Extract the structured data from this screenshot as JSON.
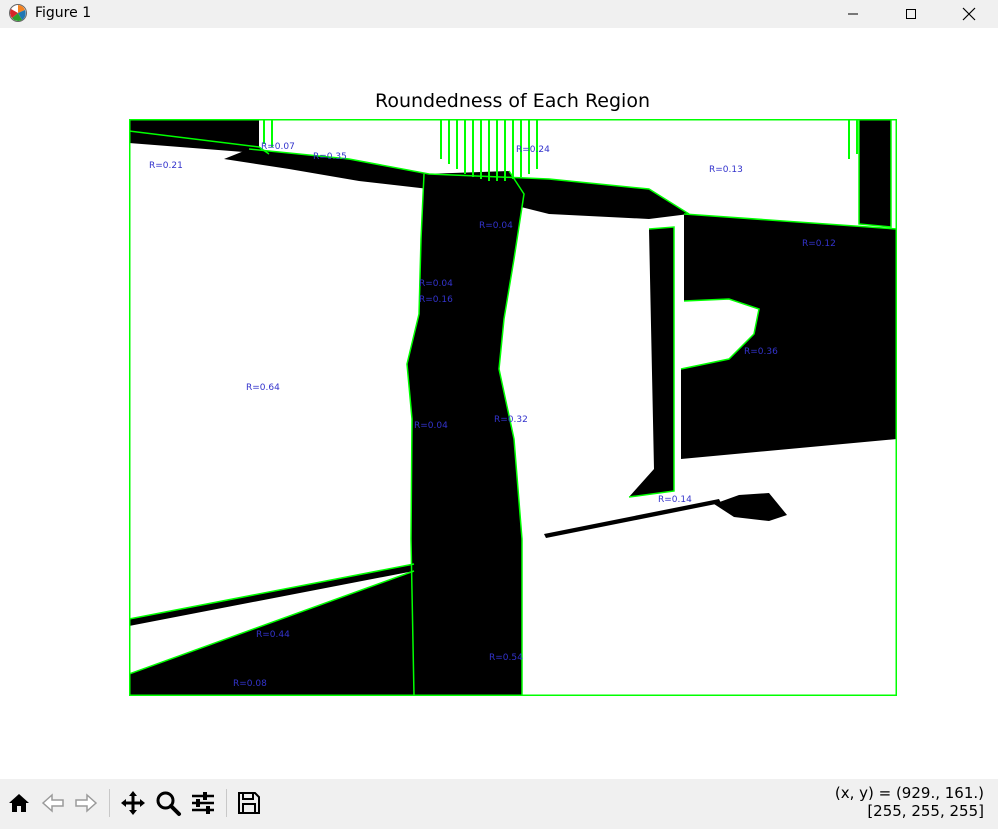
{
  "window": {
    "title": "Figure 1",
    "controls": [
      "minimize",
      "maximize",
      "close"
    ]
  },
  "figure": {
    "title": "Roundedness of Each Region",
    "contour_color": "#00ff00",
    "label_color": "#3333cc",
    "region_labels": [
      {
        "text": "R=0.07"
      },
      {
        "text": "R=0.35"
      },
      {
        "text": "R=0.24"
      },
      {
        "text": "R=0.21"
      },
      {
        "text": "R=0.13"
      },
      {
        "text": "R=0.04"
      },
      {
        "text": "R=0.04"
      },
      {
        "text": "R=0.16"
      },
      {
        "text": "R=0.64"
      },
      {
        "text": "R=0.04"
      },
      {
        "text": "R=0.32"
      },
      {
        "text": "R=0.36"
      },
      {
        "text": "R=0.14"
      },
      {
        "text": "R=0.44"
      },
      {
        "text": "R=0.54"
      },
      {
        "text": "R=0.08"
      },
      {
        "text": "R=0.12"
      }
    ]
  },
  "toolbar": {
    "buttons": [
      "home",
      "back",
      "forward",
      "pan",
      "zoom",
      "configure-subplots",
      "save"
    ]
  },
  "status": {
    "coords": "(x, y) = (929., 161.)",
    "pixel": "[255, 255, 255]"
  }
}
